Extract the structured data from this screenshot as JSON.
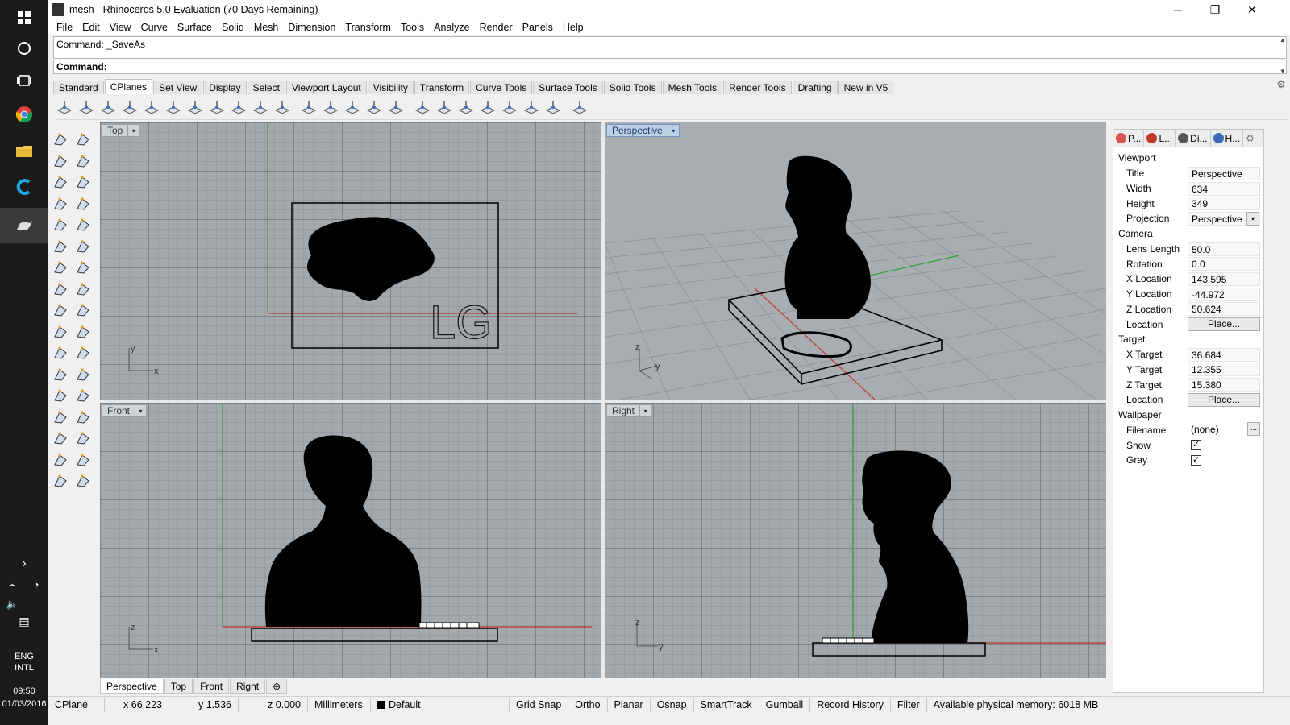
{
  "taskbar": {
    "icons": [
      "windows-logo-icon",
      "search-circle-icon",
      "task-view-icon",
      "chrome-icon",
      "file-explorer-icon",
      "ccleaner-icon",
      "rhino-icon"
    ],
    "language": [
      "ENG",
      "INTL"
    ],
    "time": "09:50",
    "date": "01/03/2016"
  },
  "window": {
    "title": "mesh - Rhinoceros 5.0 Evaluation (70 Days Remaining)",
    "min": "─",
    "max": "❐",
    "close": "✕"
  },
  "menu": [
    "File",
    "Edit",
    "View",
    "Curve",
    "Surface",
    "Solid",
    "Mesh",
    "Dimension",
    "Transform",
    "Tools",
    "Analyze",
    "Render",
    "Panels",
    "Help"
  ],
  "command": {
    "history": "Command: _SaveAs",
    "label": "Command:",
    "value": ""
  },
  "toolbar_tabs": {
    "items": [
      "Standard",
      "CPlanes",
      "Set View",
      "Display",
      "Select",
      "Viewport Layout",
      "Visibility",
      "Transform",
      "Curve Tools",
      "Surface Tools",
      "Solid Tools",
      "Mesh Tools",
      "Render Tools",
      "Drafting",
      "New in V5"
    ],
    "active": "CPlanes"
  },
  "viewports": {
    "top": {
      "label": "Top",
      "axis_v": "y",
      "axis_h": "x",
      "logo": "LG"
    },
    "perspective": {
      "label": "Perspective",
      "axis_v": "z",
      "axis_h": "y"
    },
    "front": {
      "label": "Front",
      "axis_v": "z",
      "axis_h": "x"
    },
    "right": {
      "label": "Right",
      "axis_v": "z",
      "axis_h": "y"
    },
    "dropdown": "▾"
  },
  "viewport_tabs": {
    "items": [
      "Perspective",
      "Top",
      "Front",
      "Right"
    ],
    "add": "⊕",
    "active": "Perspective"
  },
  "panel": {
    "tabs": [
      "P...",
      "L...",
      "Di...",
      "H..."
    ],
    "tab_colors": [
      "#d9534f",
      "#c0392b",
      "#555555",
      "#3b6bb5"
    ],
    "gear": "⚙",
    "viewport_section": "Viewport",
    "title_label": "Title",
    "title_value": "Perspective",
    "width_label": "Width",
    "width_value": "634",
    "height_label": "Height",
    "height_value": "349",
    "projection_label": "Projection",
    "projection_value": "Perspective",
    "camera_section": "Camera",
    "lens_label": "Lens Length",
    "lens_value": "50.0",
    "rotation_label": "Rotation",
    "rotation_value": "0.0",
    "xloc_label": "X Location",
    "xloc_value": "143.595",
    "yloc_label": "Y Location",
    "yloc_value": "-44.972",
    "zloc_label": "Z Location",
    "zloc_value": "50.624",
    "loc_label": "Location",
    "loc_button": "Place...",
    "target_section": "Target",
    "xtgt_label": "X Target",
    "xtgt_value": "36.684",
    "ytgt_label": "Y Target",
    "ytgt_value": "12.355",
    "ztgt_label": "Z Target",
    "ztgt_value": "15.380",
    "tloc_label": "Location",
    "tloc_button": "Place...",
    "wallpaper_section": "Wallpaper",
    "filename_label": "Filename",
    "filename_value": "(none)",
    "filename_button": "...",
    "show_label": "Show",
    "show_check": "✓",
    "gray_label": "Gray",
    "gray_check": "✓"
  },
  "status": {
    "cplane": "CPlane",
    "x": "x 66.223",
    "y": "y 1.536",
    "z": "z 0.000",
    "units": "Millimeters",
    "layer": "Default",
    "grid_snap": "Grid Snap",
    "ortho": "Ortho",
    "planar": "Planar",
    "osnap": "Osnap",
    "smarttrack": "SmartTrack",
    "gumball": "Gumball",
    "record_history": "Record History",
    "filter": "Filter",
    "memory": "Available physical memory: 6018 MB"
  },
  "colors": {
    "x_axis": "#c0392b",
    "y_axis": "#2e9e3a",
    "active_viewport": "#bcd0e6"
  }
}
